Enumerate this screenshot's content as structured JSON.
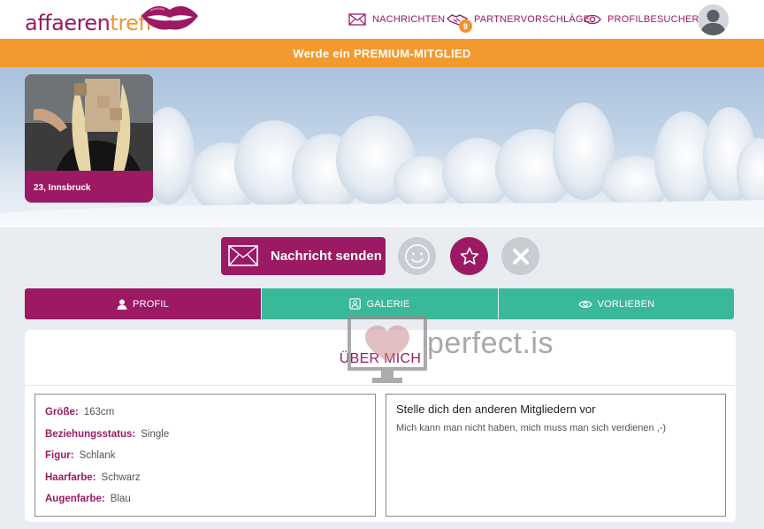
{
  "brand": {
    "part1": "affaeren",
    "part2": "treff",
    "primary": "#9c1a63",
    "accent": "#f0952e",
    "teal": "#3ab89a"
  },
  "nav": {
    "messages": {
      "label": "NACHRICHTEN",
      "icon": "envelope-icon"
    },
    "suggestions": {
      "label": "PARTNERVORSCHLÄGE",
      "badge": "9",
      "icon": "handshake-icon"
    },
    "visitors": {
      "label": "PROFILBESUCHER",
      "icon": "eye-icon"
    }
  },
  "premium_banner": {
    "text_plain": "Werde ein ",
    "text_bold": "PREMIUM-MITGLIED"
  },
  "profile": {
    "caption": "23, Innsbruck"
  },
  "actions": {
    "send_message": "Nachricht senden"
  },
  "tabs": [
    {
      "label": "PROFIL",
      "icon": "user-icon",
      "active": true
    },
    {
      "label": "GALERIE",
      "icon": "portrait-icon",
      "active": false
    },
    {
      "label": "VORLIEBEN",
      "icon": "eye-icon",
      "active": false
    }
  ],
  "about": {
    "title": "ÜBER MICH",
    "facts": [
      {
        "label": "Größe:",
        "value": "163cm"
      },
      {
        "label": "Beziehungsstatus:",
        "value": "Single"
      },
      {
        "label": "Figur:",
        "value": "Schlank"
      },
      {
        "label": "Haarfarbe:",
        "value": "Schwarz"
      },
      {
        "label": "Augenfarbe:",
        "value": "Blau"
      }
    ],
    "intro_heading": "Stelle dich den anderen Mitgliedern vor",
    "intro_text": "Mich kann man nicht haben, mich muss man sich verdienen ,-)"
  },
  "watermark": {
    "text": "perfect.is"
  }
}
